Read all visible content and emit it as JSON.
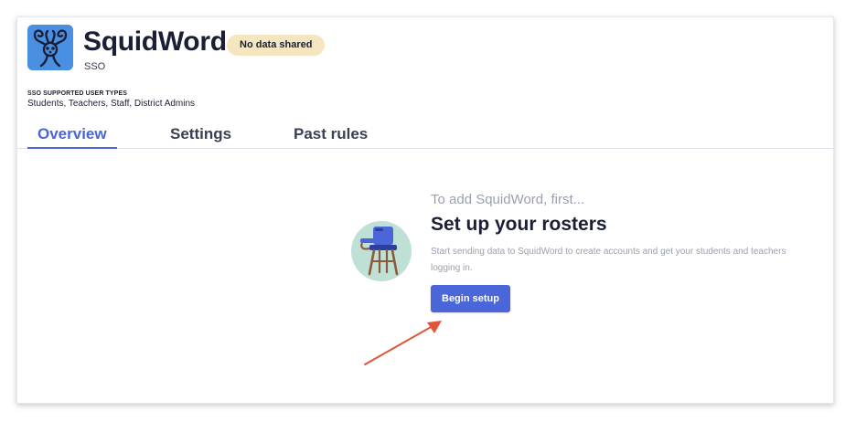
{
  "app": {
    "name": "SquidWord",
    "type_label": "SSO",
    "badge": "No data shared",
    "logo_icon": "squid-logo-icon",
    "logo_color": "#4a90e2"
  },
  "sso": {
    "label": "SSO SUPPORTED USER TYPES",
    "value": "Students, Teachers, Staff, District Admins"
  },
  "tabs": [
    {
      "label": "Overview",
      "active": true
    },
    {
      "label": "Settings",
      "active": false
    },
    {
      "label": "Past rules",
      "active": false
    }
  ],
  "setup": {
    "eyebrow": "To add SquidWord, first...",
    "headline": "Set up your rosters",
    "description": "Start sending data to SquidWord to create accounts and get your students and teachers logging in.",
    "button_label": "Begin setup",
    "illustration_icon": "school-desk-chair-icon"
  },
  "annotation": {
    "arrow_icon": "red-arrow-icon",
    "arrow_color": "#e0553a"
  },
  "colors": {
    "accent": "#4a66d8",
    "badge_bg": "#f6e6bf",
    "muted_text": "#9aa0ae"
  }
}
